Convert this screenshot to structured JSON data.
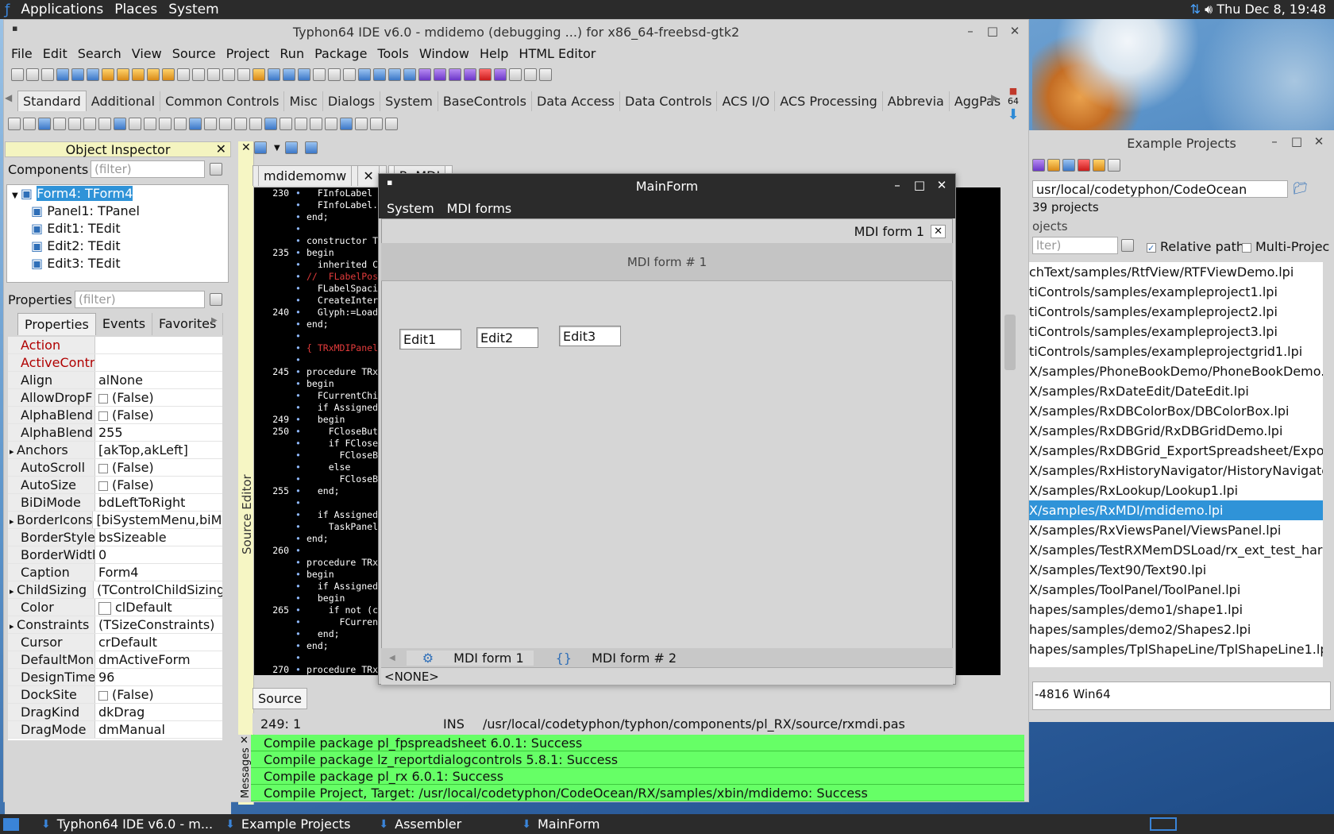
{
  "topbar": {
    "menus": [
      "Applications",
      "Places",
      "System"
    ],
    "clock": "Thu Dec  8, 19:48"
  },
  "ide": {
    "title": "Typhon64 IDE v6.0 - mdidemo (debugging ...) for x86_64-freebsd-gtk2",
    "menu": [
      "File",
      "Edit",
      "Search",
      "View",
      "Source",
      "Project",
      "Run",
      "Package",
      "Tools",
      "Window",
      "Help",
      "HTML Editor"
    ],
    "palette_tabs": [
      "Standard",
      "Additional",
      "Common Controls",
      "Misc",
      "Dialogs",
      "System",
      "BaseControls",
      "Data Access",
      "Data Controls",
      "ACS I/O",
      "ACS Processing",
      "Abbrevia",
      "AggPas"
    ],
    "palette_badge": "64"
  },
  "inspector": {
    "title": "Object Inspector",
    "components_label": "Components",
    "filter_placeholder": "(filter)",
    "tree": [
      "Form4: TForm4",
      "Panel1: TPanel",
      "Edit1: TEdit",
      "Edit2: TEdit",
      "Edit3: TEdit"
    ],
    "properties_label": "Properties",
    "tabs": [
      "Properties",
      "Events",
      "Favorites"
    ],
    "props": [
      {
        "name": "Action",
        "value": "",
        "red": true
      },
      {
        "name": "ActiveContr",
        "value": "",
        "red": true
      },
      {
        "name": "Align",
        "value": "alNone"
      },
      {
        "name": "AllowDropF",
        "value": "(False)",
        "check": true
      },
      {
        "name": "AlphaBlend",
        "value": "(False)",
        "check": true
      },
      {
        "name": "AlphaBlend",
        "value": "255"
      },
      {
        "name": "Anchors",
        "value": "[akTop,akLeft]",
        "expand": true
      },
      {
        "name": "AutoScroll",
        "value": "(False)",
        "check": true
      },
      {
        "name": "AutoSize",
        "value": "(False)",
        "check": true
      },
      {
        "name": "BiDiMode",
        "value": "bdLeftToRight"
      },
      {
        "name": "BorderIcons",
        "value": "[biSystemMenu,biMi",
        "expand": true
      },
      {
        "name": "BorderStyle",
        "value": "bsSizeable"
      },
      {
        "name": "BorderWidth",
        "value": "0"
      },
      {
        "name": "Caption",
        "value": "Form4"
      },
      {
        "name": "ChildSizing",
        "value": "(TControlChildSizing",
        "expand": true
      },
      {
        "name": "Color",
        "value": "clDefault",
        "swatch": true
      },
      {
        "name": "Constraints",
        "value": "(TSizeConstraints)",
        "expand": true
      },
      {
        "name": "Cursor",
        "value": "crDefault"
      },
      {
        "name": "DefaultMoni",
        "value": "dmActiveForm"
      },
      {
        "name": "DesignTime",
        "value": "96"
      },
      {
        "name": "DockSite",
        "value": "(False)",
        "check": true
      },
      {
        "name": "DragKind",
        "value": "dkDrag"
      },
      {
        "name": "DragMode",
        "value": "dmManual"
      }
    ]
  },
  "editor": {
    "vertical_label": "Source Editor",
    "tabs": [
      "mdidemomw",
      "RxMDI"
    ],
    "source_tab": "Source",
    "status_pos": "249:  1",
    "status_mode": "INS",
    "status_file": "/usr/local/codetyphon/typhon/components/pl_RX/source/rxmdi.pas",
    "lines": [
      {
        "n": "230",
        "t": "  FInfoLabel :="
      },
      {
        "n": "",
        "t": "  FInfoLabel.Co"
      },
      {
        "n": "",
        "t": "end;"
      },
      {
        "n": "",
        "t": ""
      },
      {
        "n": "",
        "t": "constructor TRx"
      },
      {
        "n": "235",
        "t": "begin"
      },
      {
        "n": "",
        "t": "  inherited Cre"
      },
      {
        "n": "",
        "t": "//  FLabelPosit",
        "c": true
      },
      {
        "n": "",
        "t": "  FLabelSpacing"
      },
      {
        "n": "",
        "t": "  CreateInterna"
      },
      {
        "n": "240",
        "t": "  Glyph:=LoadLa"
      },
      {
        "n": "",
        "t": "end;"
      },
      {
        "n": "",
        "t": ""
      },
      {
        "n": "",
        "t": "{ TRxMDIPanel }",
        "c": true
      },
      {
        "n": "",
        "t": ""
      },
      {
        "n": "245",
        "t": "procedure TRxMD"
      },
      {
        "n": "",
        "t": "begin"
      },
      {
        "n": "",
        "t": "  FCurrentChild"
      },
      {
        "n": "",
        "t": "  if Assigned(F"
      },
      {
        "n": "249",
        "t": "  begin"
      },
      {
        "n": "250",
        "t": "    FCloseButto"
      },
      {
        "n": "",
        "t": "    if FCloseBu"
      },
      {
        "n": "",
        "t": "      FCloseBut"
      },
      {
        "n": "",
        "t": "    else"
      },
      {
        "n": "",
        "t": "      FCloseBut"
      },
      {
        "n": "255",
        "t": "  end;"
      },
      {
        "n": "",
        "t": ""
      },
      {
        "n": "",
        "t": "  if Assigned(T"
      },
      {
        "n": "",
        "t": "    TaskPanel.V"
      },
      {
        "n": "",
        "t": "end;"
      },
      {
        "n": "260",
        "t": ""
      },
      {
        "n": "",
        "t": "procedure TRxMD"
      },
      {
        "n": "",
        "t": "begin"
      },
      {
        "n": "",
        "t": "  if Assigned(F"
      },
      {
        "n": "",
        "t": "  begin"
      },
      {
        "n": "265",
        "t": "    if not (csD"
      },
      {
        "n": "",
        "t": "      FCurrentC"
      },
      {
        "n": "",
        "t": "  end;"
      },
      {
        "n": "",
        "t": "end;"
      },
      {
        "n": "",
        "t": ""
      },
      {
        "n": "270",
        "t": "procedure TRxMD"
      }
    ]
  },
  "messages": {
    "vertical_label": "Messages",
    "lines": [
      "Compile package pl_fpspreadsheet 6.0.1: Success",
      "Compile package lz_reportdialogcontrols 5.8.1: Success",
      "Compile package pl_rx 6.0.1: Success",
      "Compile Project, Target: /usr/local/codetyphon/CodeOcean/RX/samples/xbin/mdidemo: Success"
    ]
  },
  "mainform": {
    "title": "MainForm",
    "menu": [
      "System",
      "MDI forms"
    ],
    "child_title": "MDI form 1",
    "info": "MDI form # 1",
    "edits": [
      "Edit1",
      "Edit2",
      "Edit3"
    ],
    "task_tabs": [
      "MDI form 1",
      "MDI form # 2"
    ],
    "status": "<NONE>"
  },
  "examples": {
    "title": "Example Projects",
    "path": "usr/local/codetyphon/CodeOcean",
    "count": "39 projects",
    "projects_label": "ojects",
    "filter": "lter)",
    "relative_paths": "Relative paths",
    "multi": "Multi-Projec",
    "items": [
      "chText/samples/RtfView/RTFViewDemo.lpi",
      "tiControls/samples/exampleproject1.lpi",
      "tiControls/samples/exampleproject2.lpi",
      "tiControls/samples/exampleproject3.lpi",
      "tiControls/samples/exampleprojectgrid1.lpi",
      "X/samples/PhoneBookDemo/PhoneBookDemo.lp",
      "X/samples/RxDateEdit/DateEdit.lpi",
      "X/samples/RxDBColorBox/DBColorBox.lpi",
      "X/samples/RxDBGrid/RxDBGridDemo.lpi",
      "X/samples/RxDBGrid_ExportSpreadsheet/Export",
      "X/samples/RxHistoryNavigator/HistoryNavigator.l",
      "X/samples/RxLookup/Lookup1.lpi",
      "X/samples/RxMDI/mdidemo.lpi",
      "X/samples/RxViewsPanel/ViewsPanel.lpi",
      "X/samples/TestRXMemDSLoad/rx_ext_test_harn",
      "X/samples/Text90/Text90.lpi",
      "X/samples/ToolPanel/ToolPanel.lpi",
      "hapes/samples/demo1/shape1.lpi",
      "hapes/samples/demo2/Shapes2.lpi",
      "hapes/samples/TplShapeLine/TplShapeLine1.lpi"
    ],
    "selected": "X/samples/RxMDI/mdidemo.lpi",
    "footer": "-4816 Win64"
  },
  "taskbar": [
    "Typhon64 IDE v6.0 - m...",
    "Example Projects",
    "Assembler",
    "MainForm"
  ]
}
